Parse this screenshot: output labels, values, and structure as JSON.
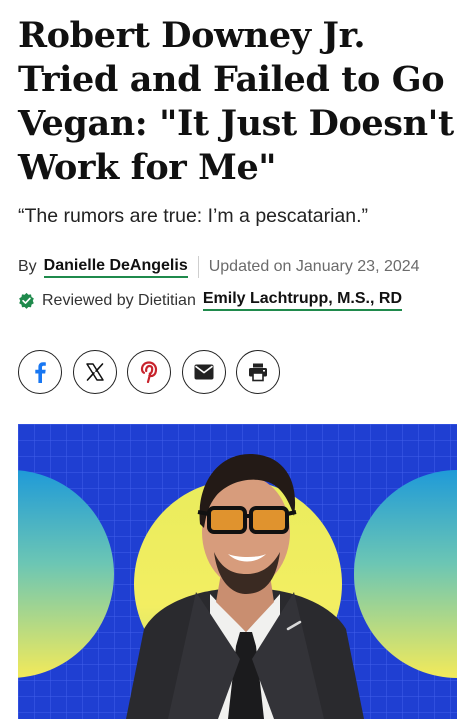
{
  "article": {
    "headline": "Robert Downey Jr. Tried and Failed to Go Vegan: \"It Just Doesn't Work for Me\"",
    "dek": "“The rumors are true: I’m a pescatarian.”",
    "byline": {
      "prefix": "By",
      "author": "Danielle DeAngelis",
      "updated": "Updated on January 23, 2024"
    },
    "review": {
      "prefix": "Reviewed by Dietitian",
      "reviewer": "Emily Lachtrupp, M.S., RD"
    }
  },
  "share": {
    "buttons": [
      "facebook-icon",
      "x-icon",
      "pinterest-icon",
      "email-icon",
      "print-icon"
    ]
  },
  "colors": {
    "accent_green": "#1f8a4c",
    "hero_blue": "#1e3fcf",
    "facebook_blue": "#1877f2",
    "pinterest_red": "#c8232c"
  }
}
